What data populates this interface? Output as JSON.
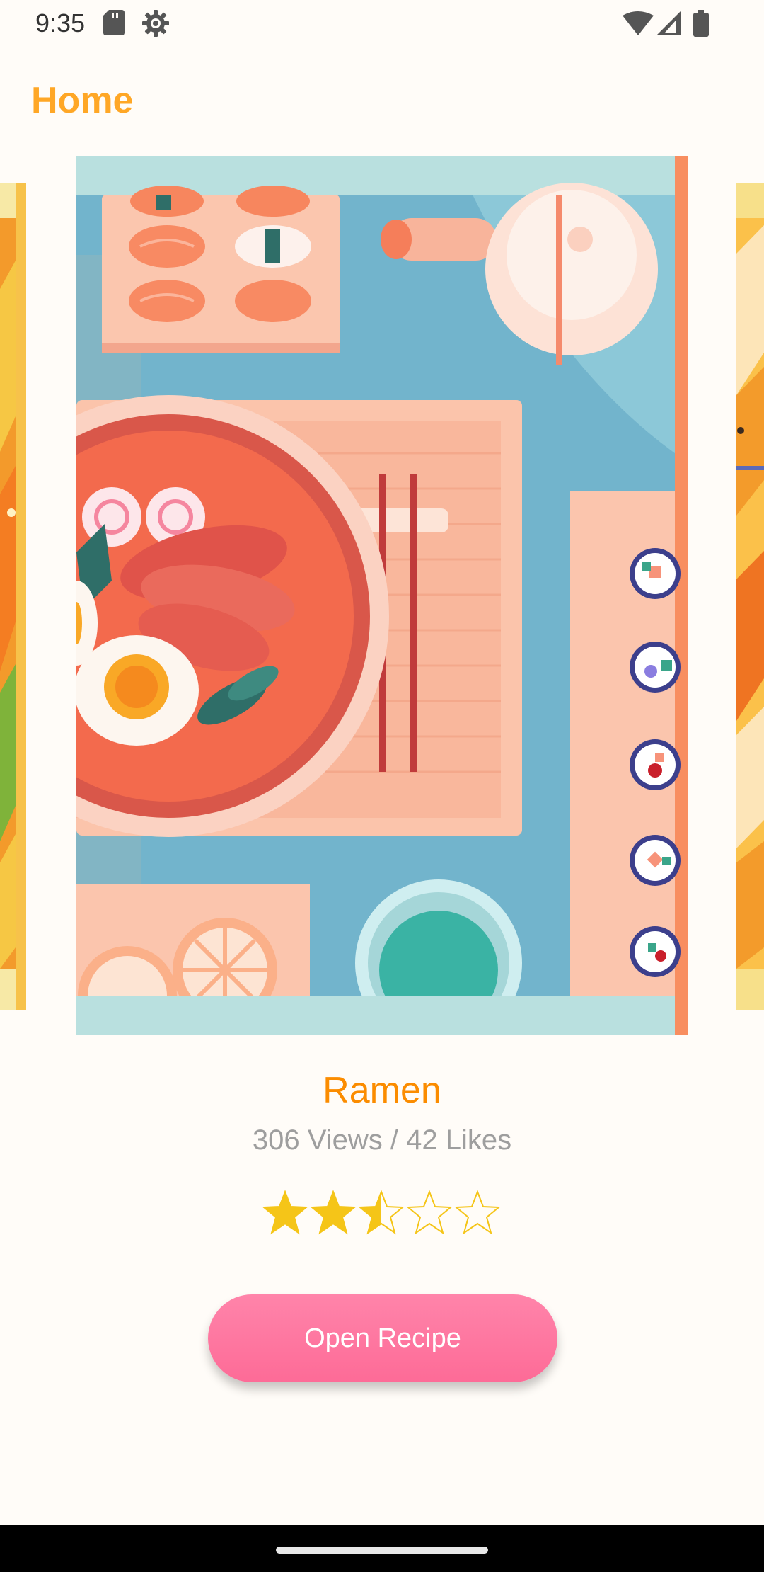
{
  "status_bar": {
    "time": "9:35",
    "left_icons": [
      "sd-card-icon",
      "settings-gear-icon"
    ],
    "right_icons": [
      "wifi-icon",
      "cellular-signal-icon",
      "battery-icon"
    ]
  },
  "header": {
    "title": "Home"
  },
  "carousel": {
    "current": {
      "image": "ramen-illustration",
      "name": "Ramen",
      "views": 306,
      "likes": 42,
      "stats_text": "306 Views /  42 Likes",
      "rating": 2.5,
      "rating_max": 5
    }
  },
  "actions": {
    "open_recipe_label": "Open Recipe"
  },
  "colors": {
    "accent_orange": "#ffa726",
    "title_orange": "#fb8c00",
    "button_pink": "#fe7aa2",
    "star_gold": "#f5c518",
    "stats_gray": "#9e9e9e",
    "background": "#fffcf8"
  }
}
